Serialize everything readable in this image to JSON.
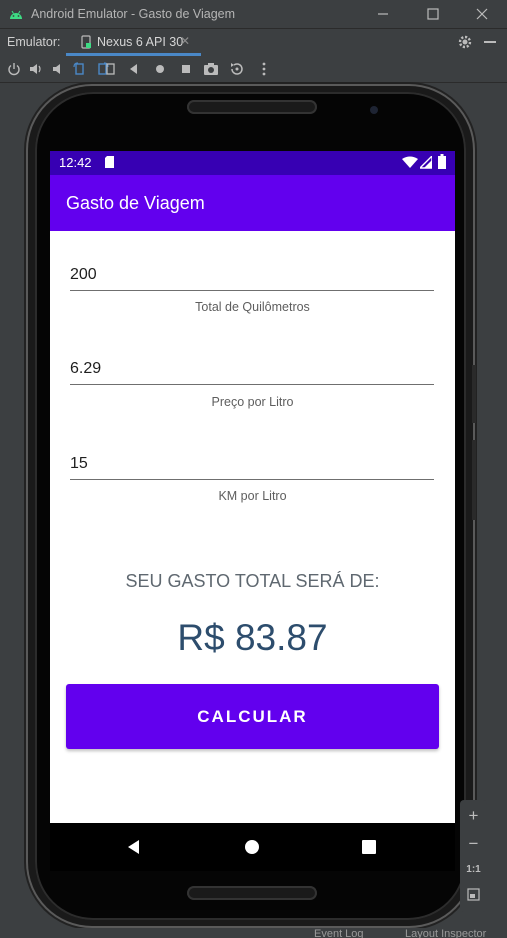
{
  "window": {
    "title": "Android Emulator - Gasto de Viagem"
  },
  "emulator_bar": {
    "label": "Emulator:",
    "device_tab": "Nexus 6 API 30",
    "close_glyph": "✕"
  },
  "colors": {
    "statusbar": "#3700b3",
    "primary": "#6200ee",
    "result_text": "#2d4d6d"
  },
  "status": {
    "time": "12:42"
  },
  "app": {
    "title": "Gasto de Viagem",
    "fields": [
      {
        "value": "200",
        "caption": "Total de Quilômetros"
      },
      {
        "value": "6.29",
        "caption": "Preço por Litro"
      },
      {
        "value": "15",
        "caption": "KM por Litro"
      }
    ],
    "result_label": "SEU GASTO TOTAL SERÁ DE:",
    "result_value": "R$ 83.87",
    "calc_button": "CALCULAR"
  },
  "zoom_panel": {
    "zoom_in": "+",
    "zoom_out": "−",
    "one_to_one": "1:1"
  },
  "bottom_bar": {
    "event_log": "Event Log",
    "layout_inspector": "Layout Inspector"
  }
}
